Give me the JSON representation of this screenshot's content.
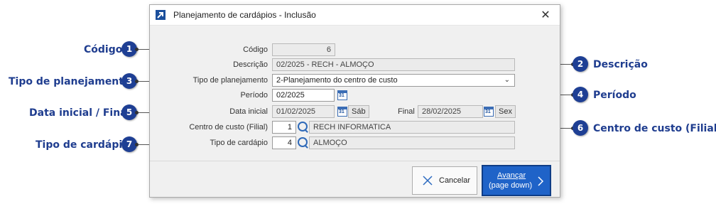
{
  "callouts": [
    {
      "number": "1",
      "label": "Código"
    },
    {
      "number": "2",
      "label": "Descrição"
    },
    {
      "number": "3",
      "label": "Tipo de planejamento"
    },
    {
      "number": "4",
      "label": "Período"
    },
    {
      "number": "5",
      "label": "Data inicial / Final"
    },
    {
      "number": "6",
      "label": "Centro de custo (Filial)"
    },
    {
      "number": "7",
      "label": "Tipo de cardápio"
    }
  ],
  "dialog": {
    "title": "Planejamento de cardápios - Inclusão",
    "close_symbol": "✕",
    "fields": {
      "codigo_label": "Código",
      "codigo_value": "6",
      "descricao_label": "Descrição",
      "descricao_value": "02/2025 - RECH - ALMOÇO",
      "tipo_planejamento_label": "Tipo de planejamento",
      "tipo_planejamento_value": "2-Planejamento do centro de custo",
      "periodo_label": "Período",
      "periodo_value": "02/2025",
      "data_inicial_label": "Data inicial",
      "data_inicial_value": "01/02/2025",
      "data_inicial_day": "Sáb",
      "final_label": "Final",
      "final_value": "28/02/2025",
      "final_day": "Sex",
      "centro_custo_label": "Centro de custo (Filial)",
      "centro_custo_code": "1",
      "centro_custo_name": "RECH INFORMATICA",
      "tipo_cardapio_label": "Tipo de cardápio",
      "tipo_cardapio_code": "4",
      "tipo_cardapio_name": "ALMOÇO",
      "calendar_digits": "31"
    },
    "buttons": {
      "cancel_label": "Cancelar",
      "next_label": "Avançar",
      "next_hint": "(page down)"
    }
  },
  "colors": {
    "accent": "#1e3f94",
    "primary_button": "#1f63c8"
  }
}
